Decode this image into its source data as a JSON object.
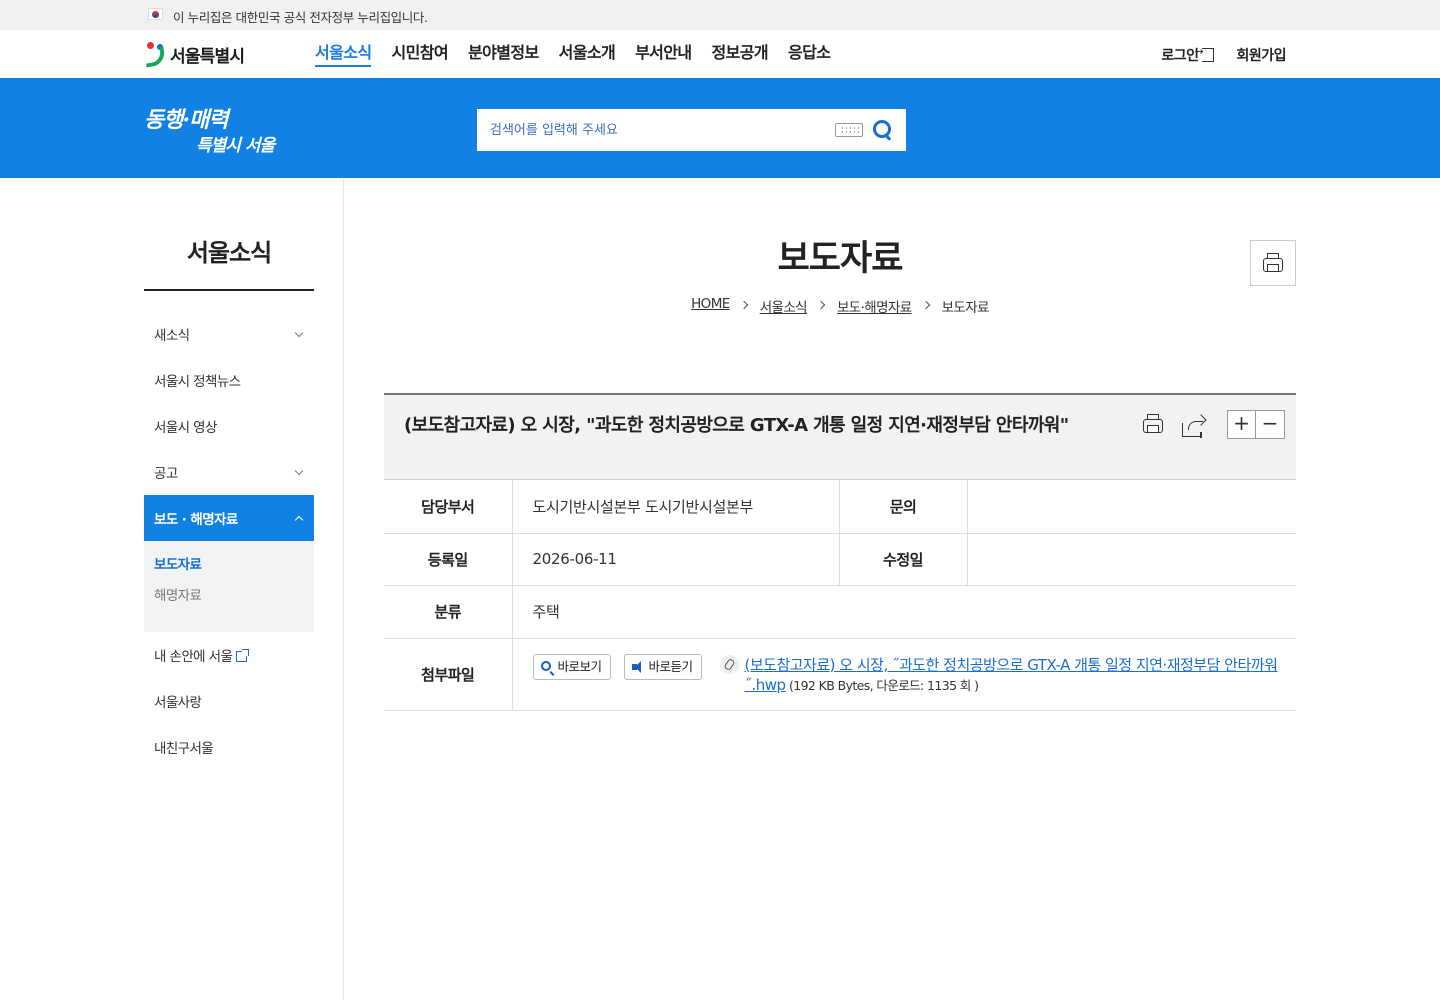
{
  "gov_bar": {
    "text": "이 누리집은 대한민국 공식 전자정부 누리집입니다."
  },
  "logo": {
    "text": "서울특별시"
  },
  "gnb": {
    "items": [
      "서울소식",
      "시민참여",
      "분야별정보",
      "서울소개",
      "부서안내",
      "정보공개",
      "응답소"
    ],
    "active_index": 0,
    "login": "로그인",
    "signup": "회원가입"
  },
  "banner": {
    "slogan_line1": "동행·매력",
    "slogan_line2": "특별시 서울",
    "search_placeholder": "검색어를 입력해 주세요"
  },
  "lnb": {
    "title": "서울소식",
    "items": [
      {
        "label": "새소식",
        "expandable": true
      },
      {
        "label": "서울시 정책뉴스",
        "expandable": false
      },
      {
        "label": "서울시 영상",
        "expandable": false
      },
      {
        "label": "공고",
        "expandable": true
      },
      {
        "label": "보도 · 해명자료",
        "expandable": true,
        "active": true
      },
      {
        "label": "내 손안에 서울",
        "external": true
      },
      {
        "label": "서울사랑",
        "expandable": false
      },
      {
        "label": "내친구서울",
        "expandable": false
      }
    ],
    "sub_items": [
      "보도자료",
      "해명자료"
    ],
    "sub_active_index": 0
  },
  "page": {
    "title": "보도자료",
    "breadcrumb": [
      "HOME",
      "서울소식",
      "보도·해명자료",
      "보도자료"
    ]
  },
  "article": {
    "title": "(보도참고자료) 오 시장, \"과도한 정치공방으로 GTX-A 개통 일정 지연·재정부담 안타까워\"",
    "zoom_in": "+",
    "zoom_out": "−",
    "labels": {
      "dept": "담당부서",
      "contact": "문의",
      "registered": "등록일",
      "modified": "수정일",
      "category": "분류",
      "attachment": "첨부파일"
    },
    "dept": "도시기반시설본부 도시기반시설본부",
    "contact": "",
    "registered": "2026-06-11",
    "modified": "",
    "category": "주택",
    "attachment": {
      "view_label": "바로보기",
      "listen_label": "바로듣기",
      "filename": "(보도참고자료) 오 시장, ˝과도한 정치공방으로 GTX-A 개통 일정 지연·재정부담 안타까워˝.hwp",
      "meta": " (192 KB Bytes, 다운로드: 1135 회 )"
    }
  }
}
